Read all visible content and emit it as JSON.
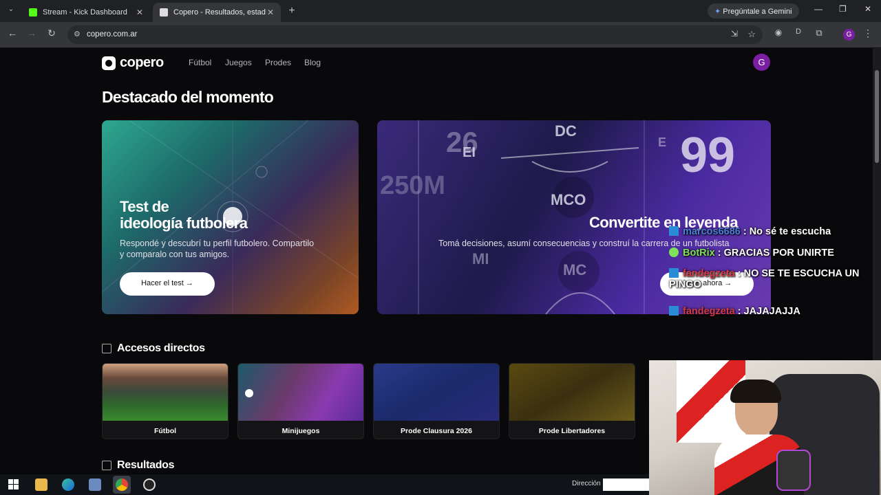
{
  "browser": {
    "tabs": [
      {
        "title": "Stream - Kick Dashboard"
      },
      {
        "title": "Copero - Resultados, estadístic"
      }
    ],
    "url": "copero.com.ar",
    "gemini_label": "Pregúntale a Gemini",
    "profile_initial": "G"
  },
  "site": {
    "logo": "copero",
    "nav": [
      "Fútbol",
      "Juegos",
      "Prodes",
      "Blog"
    ],
    "avatar": "G",
    "heading": "Destacado del momento",
    "card1": {
      "title_line1": "Test de",
      "title_line2": "ideología futbolera",
      "desc_line1": "Respondé y descubrí tu perfil futbolero. Compartilo",
      "desc_line2": "y comparalo con tus amigos.",
      "button": "Hacer el test"
    },
    "card2": {
      "title": "Convertite en leyenda",
      "desc": "Tomá decisiones, asumí consecuencias y construí la carrera de un futbolista",
      "button": "Jugar ahora",
      "bg_labels": [
        "DC",
        "EI",
        "MCO",
        "MI",
        "MC",
        "99",
        "E",
        "250M",
        "26"
      ]
    },
    "shortcuts_title": "Accesos directos",
    "shortcuts": [
      "Fútbol",
      "Minijuegos",
      "Prode Clausura 2026",
      "Prode Libertadores"
    ],
    "results_title": "Resultados"
  },
  "overlay_chat": [
    {
      "user": "marcos6686",
      "color": "#4a7fd4",
      "message": ": No sé te escucha"
    },
    {
      "user": "BotRix",
      "color": "#7fe05a",
      "message": ": GRACIAS POR UNIRTE"
    },
    {
      "user": "fandegzeta",
      "color": "#d43a4a",
      "message": ": NO SE TE ESCUCHA UN",
      "message2": "PINGO"
    },
    {
      "user": "fandegzeta",
      "color": "#d43a4a",
      "message": ": JAJAJAJJA"
    }
  ],
  "taskbar": {
    "address_label": "Dirección"
  }
}
